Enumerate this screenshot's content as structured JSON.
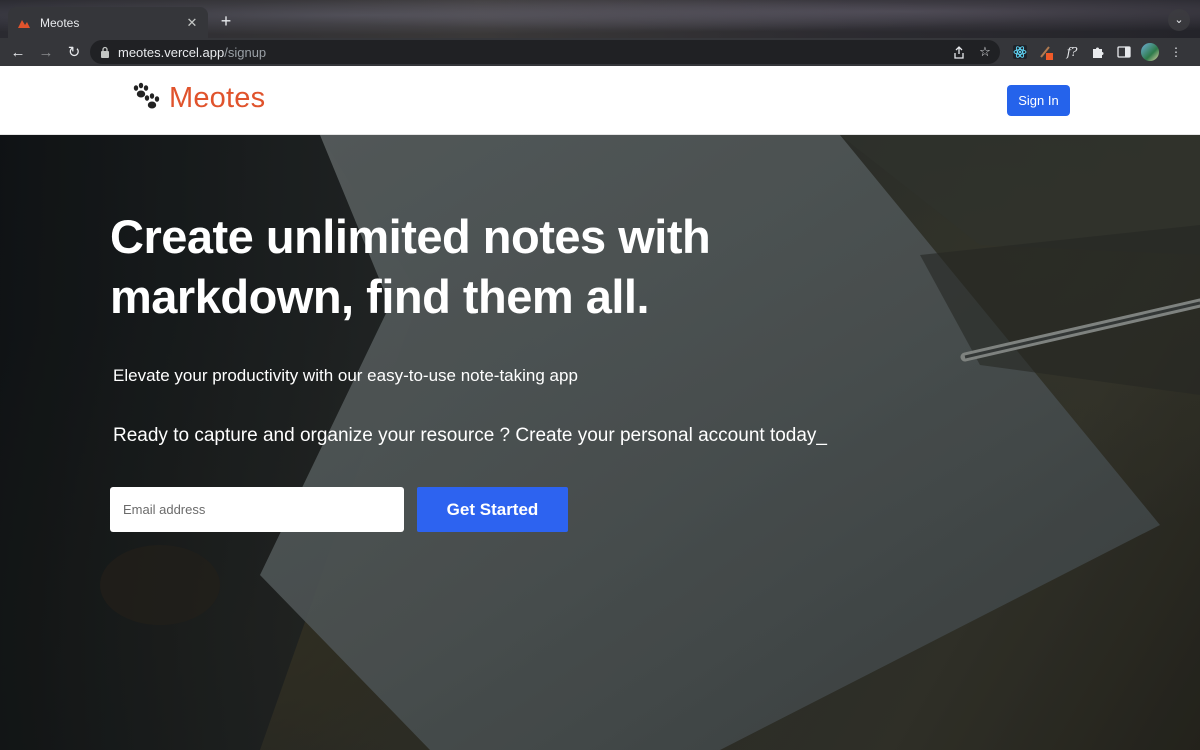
{
  "browser": {
    "tab_title": "Meotes",
    "new_tab_symbol": "+",
    "close_symbol": "✕",
    "url_host": "meotes.vercel.app",
    "url_path": "/signup",
    "icons": [
      "back-icon",
      "forward-icon",
      "reload-icon",
      "lock-icon",
      "share-icon",
      "bookmark-star-icon",
      "react-devtools-icon",
      "extension-icon",
      "formula-icon",
      "puzzle-extensions-icon",
      "side-panel-icon",
      "profile-avatar-icon",
      "tab-search-icon"
    ]
  },
  "site": {
    "brand": "Meotes",
    "brand_color": "#e0532c",
    "signin_label": "Sign In",
    "accent_color": "#2563eb"
  },
  "hero": {
    "headline": "Create unlimited notes with markdown, find them all.",
    "tagline": "Elevate your productivity with our easy-to-use note-taking app",
    "prompt": "Ready to capture and organize your resource ? Create your personal account today_",
    "email_placeholder": "Email address",
    "cta_label": "Get Started"
  }
}
